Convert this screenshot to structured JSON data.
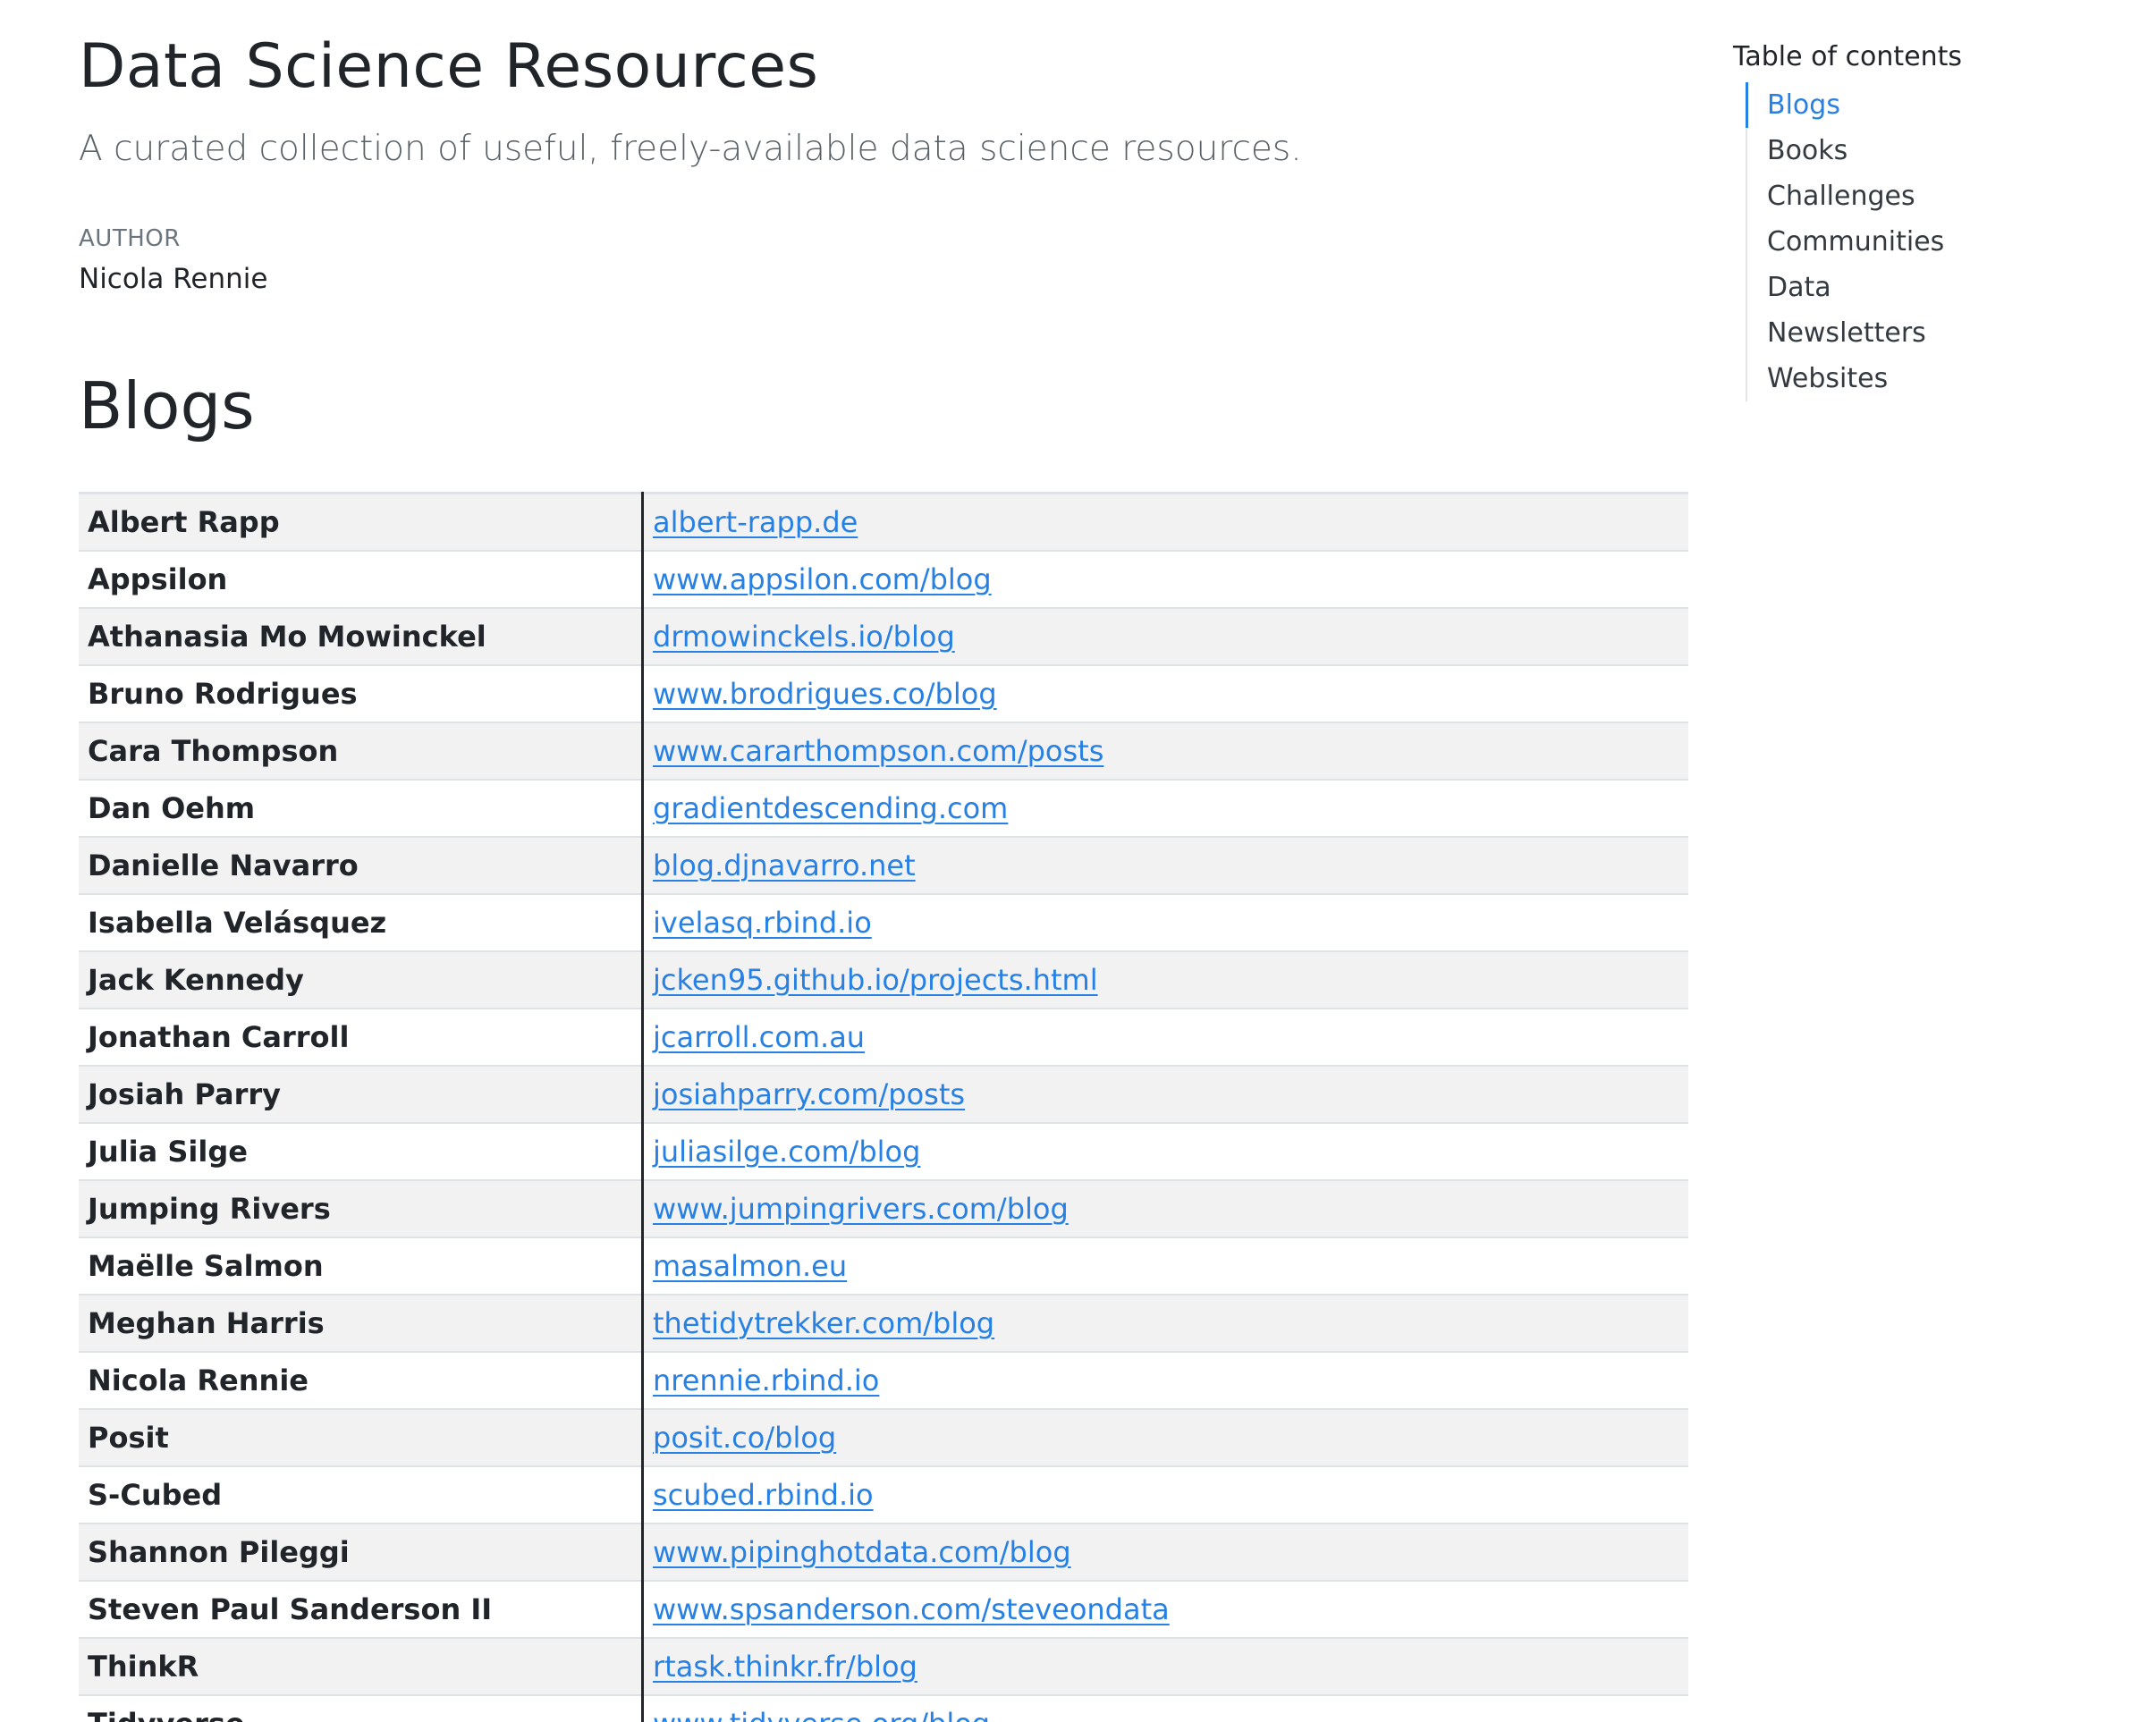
{
  "header": {
    "title": "Data Science Resources",
    "subtitle": "A curated collection of useful, freely-available data science resources.",
    "author_label": "AUTHOR",
    "author_name": "Nicola Rennie"
  },
  "section": {
    "heading": "Blogs"
  },
  "table": {
    "rows": [
      {
        "name": "Albert Rapp",
        "link": "albert-rapp.de"
      },
      {
        "name": "Appsilon",
        "link": "www.appsilon.com/blog"
      },
      {
        "name": "Athanasia Mo Mowinckel",
        "link": "drmowinckels.io/blog"
      },
      {
        "name": "Bruno Rodrigues",
        "link": "www.brodrigues.co/blog"
      },
      {
        "name": "Cara Thompson",
        "link": "www.cararthompson.com/posts"
      },
      {
        "name": "Dan Oehm",
        "link": "gradientdescending.com"
      },
      {
        "name": "Danielle Navarro",
        "link": "blog.djnavarro.net"
      },
      {
        "name": "Isabella Velásquez",
        "link": "ivelasq.rbind.io"
      },
      {
        "name": "Jack Kennedy",
        "link": "jcken95.github.io/projects.html"
      },
      {
        "name": "Jonathan Carroll",
        "link": "jcarroll.com.au"
      },
      {
        "name": "Josiah Parry",
        "link": "josiahparry.com/posts"
      },
      {
        "name": "Julia Silge",
        "link": "juliasilge.com/blog"
      },
      {
        "name": "Jumping Rivers",
        "link": "www.jumpingrivers.com/blog"
      },
      {
        "name": "Maëlle Salmon",
        "link": "masalmon.eu"
      },
      {
        "name": "Meghan Harris",
        "link": "thetidytrekker.com/blog"
      },
      {
        "name": "Nicola Rennie",
        "link": "nrennie.rbind.io"
      },
      {
        "name": "Posit",
        "link": "posit.co/blog"
      },
      {
        "name": "S-Cubed",
        "link": "scubed.rbind.io"
      },
      {
        "name": "Shannon Pileggi",
        "link": "www.pipinghotdata.com/blog"
      },
      {
        "name": "Steven Paul Sanderson II",
        "link": "www.spsanderson.com/steveondata"
      },
      {
        "name": "ThinkR",
        "link": "rtask.thinkr.fr/blog"
      },
      {
        "name": "Tidyverse",
        "link": "www.tidyverse.org/blog"
      }
    ]
  },
  "toc": {
    "title": "Table of contents",
    "items": [
      {
        "label": "Blogs",
        "active": true
      },
      {
        "label": "Books",
        "active": false
      },
      {
        "label": "Challenges",
        "active": false
      },
      {
        "label": "Communities",
        "active": false
      },
      {
        "label": "Data",
        "active": false
      },
      {
        "label": "Newsletters",
        "active": false
      },
      {
        "label": "Websites",
        "active": false
      }
    ]
  },
  "colors": {
    "link": "#2780e3",
    "text": "#212529",
    "muted": "#6c757d",
    "stripe": "#f2f2f2"
  }
}
